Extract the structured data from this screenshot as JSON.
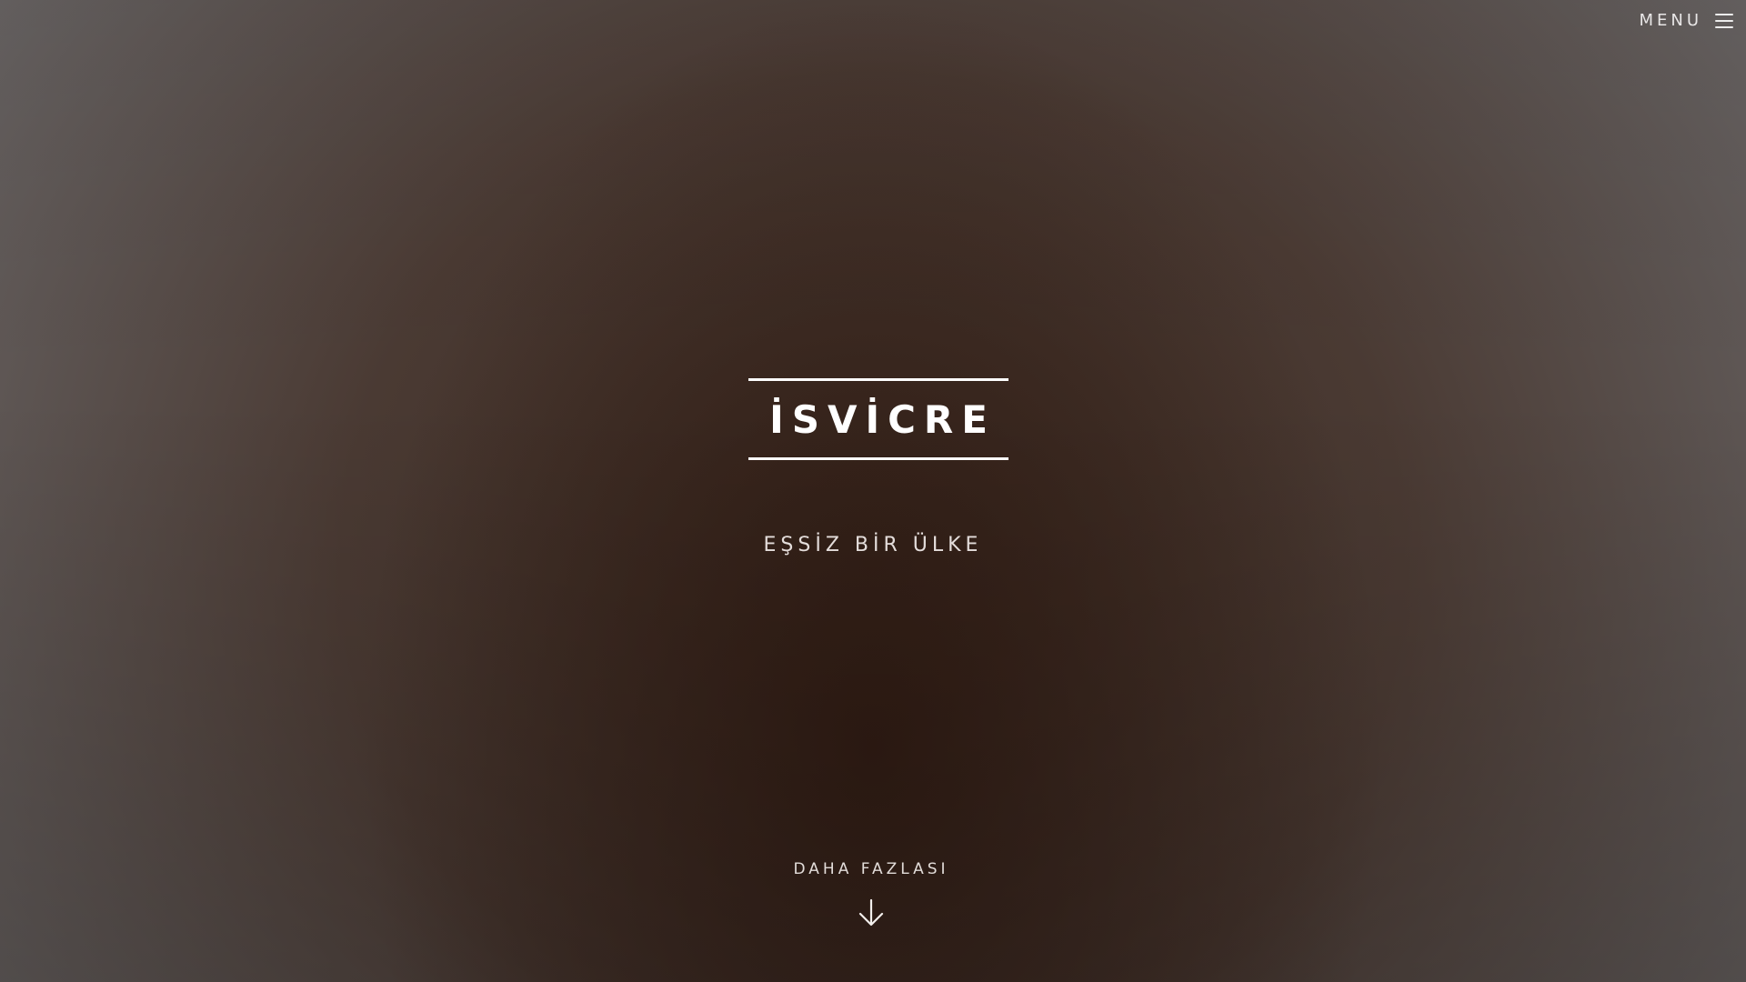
{
  "header": {
    "menu_label": "MENU",
    "menu_icon": "hamburger-icon"
  },
  "hero": {
    "title": "İSVİCRE",
    "subtitle": "EŞSİZ BİR ÜLKE",
    "more_label": "DAHA FAZLASI",
    "more_icon": "arrow-down-icon"
  },
  "colors": {
    "text": "#ffffff",
    "background_center": "#3b2a21",
    "background_edge": "#6e6c6d"
  }
}
